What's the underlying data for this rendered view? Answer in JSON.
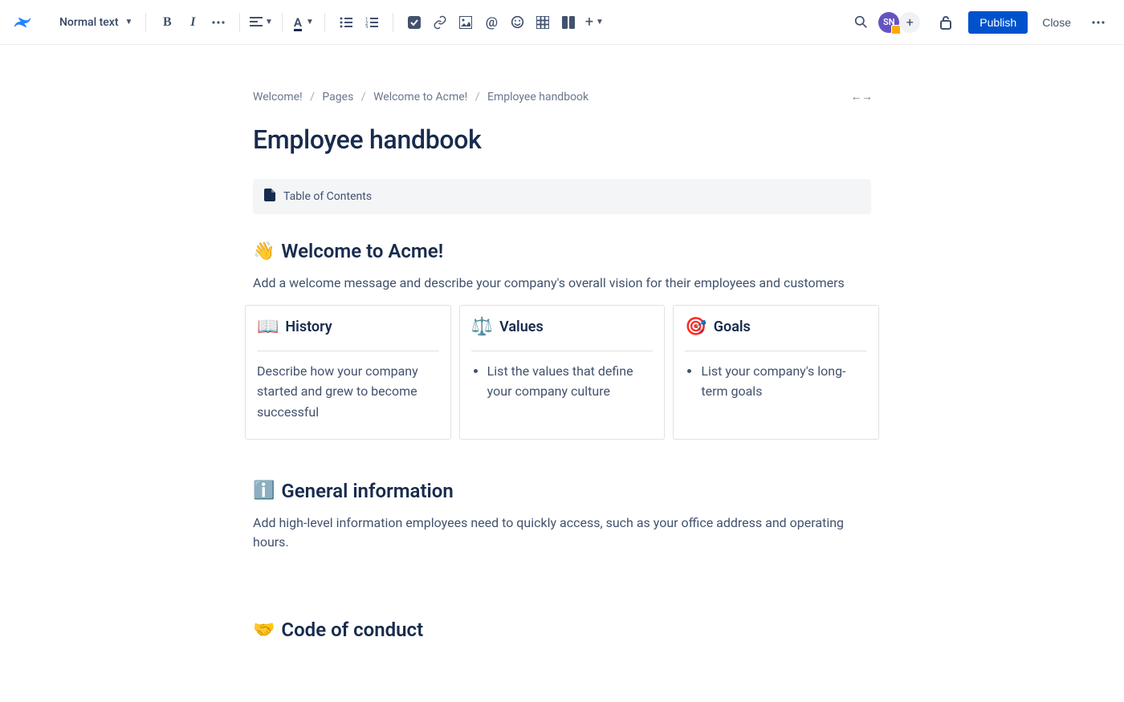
{
  "toolbar": {
    "text_style": "Normal text",
    "avatar_initials": "SN",
    "publish_label": "Publish",
    "close_label": "Close"
  },
  "breadcrumbs": [
    "Welcome!",
    "Pages",
    "Welcome to Acme!",
    "Employee handbook"
  ],
  "page_title": "Employee handbook",
  "toc_label": "Table of Contents",
  "sections": {
    "welcome": {
      "emoji": "👋",
      "heading": "Welcome to Acme!",
      "body": "Add a welcome message and describe your company's overall vision for their employees and customers",
      "cards": [
        {
          "emoji": "📖",
          "title": "History",
          "type": "paragraph",
          "body": "Describe how your company started and grew to become successful"
        },
        {
          "emoji": "⚖️",
          "title": "Values",
          "type": "list",
          "items": [
            "List the values that define your company culture"
          ]
        },
        {
          "emoji": "🎯",
          "title": "Goals",
          "type": "list",
          "items": [
            "List your company's long-term goals"
          ]
        }
      ]
    },
    "general": {
      "emoji": "ℹ️",
      "heading": "General information",
      "body": "Add high-level information employees need to quickly access, such as your office address and operating hours."
    },
    "conduct": {
      "emoji": "🤝",
      "heading": "Code of conduct"
    }
  }
}
